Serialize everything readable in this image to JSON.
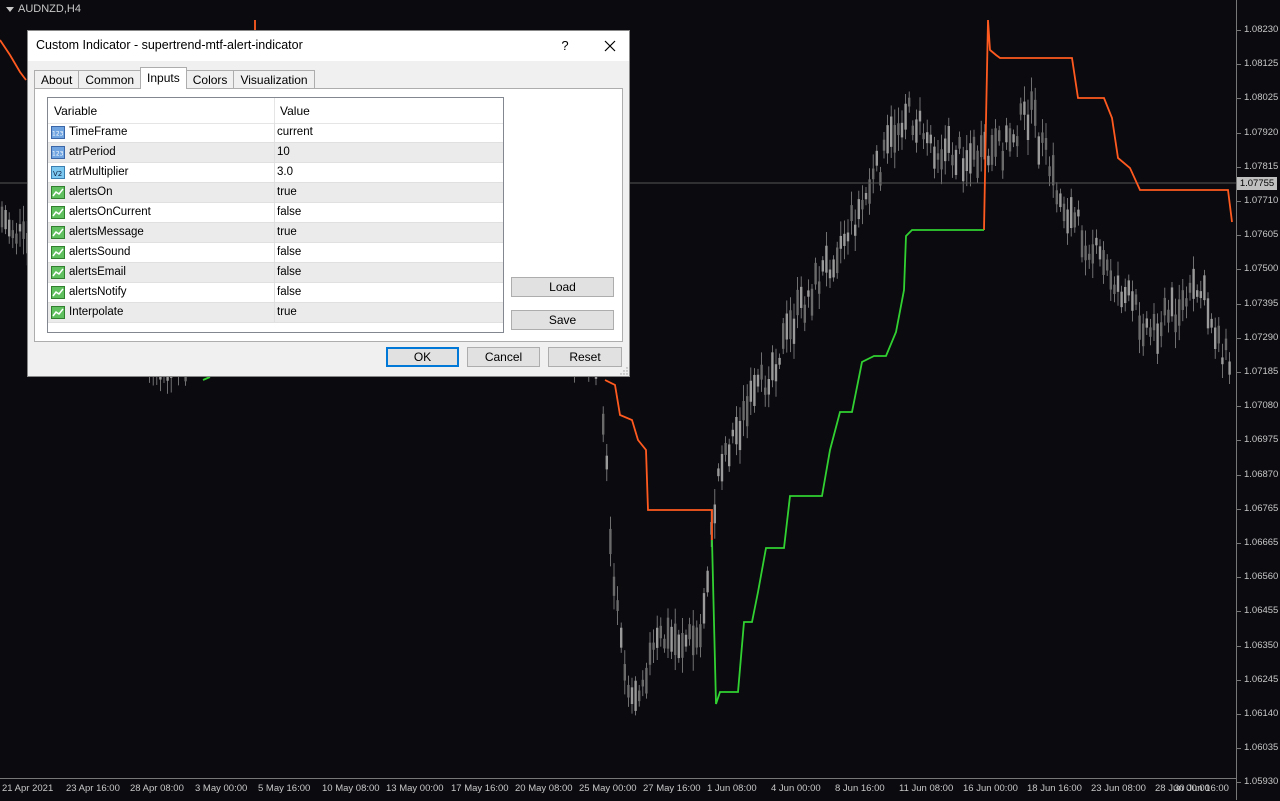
{
  "chart": {
    "symbol": "AUDNZD,H4",
    "colors": {
      "background": "#0a0a0f",
      "candle": "#8a8a8a",
      "trend_down": "#ff5a1f",
      "trend_up": "#32d132",
      "axis_text": "#c8c8c8"
    },
    "current_price": "1.07755",
    "price_ticks": [
      "1.08230",
      "1.08125",
      "1.08025",
      "1.07920",
      "1.07815",
      "1.07710",
      "1.07605",
      "1.07500",
      "1.07395",
      "1.07290",
      "1.07185",
      "1.07080",
      "1.06975",
      "1.06870",
      "1.06765",
      "1.06665",
      "1.06560",
      "1.06455",
      "1.06350",
      "1.06245",
      "1.06140",
      "1.06035",
      "1.05930"
    ],
    "time_ticks": [
      "21 Apr 2021",
      "23 Apr 16:00",
      "28 Apr 08:00",
      "3 May 00:00",
      "5 May 16:00",
      "10 May 08:00",
      "13 May 00:00",
      "17 May 16:00",
      "20 May 08:00",
      "25 May 00:00",
      "27 May 16:00",
      "1 Jun 08:00",
      "4 Jun 00:00",
      "8 Jun 16:00",
      "11 Jun 08:00",
      "16 Jun 00:00",
      "18 Jun 16:00",
      "23 Jun 08:00",
      "28 Jun 00:00",
      "30 Jun 16:00"
    ]
  },
  "dialog": {
    "title": "Custom Indicator - supertrend-mtf-alert-indicator",
    "help_label": "?",
    "tabs": [
      {
        "label": "About"
      },
      {
        "label": "Common"
      },
      {
        "label": "Inputs"
      },
      {
        "label": "Colors"
      },
      {
        "label": "Visualization"
      }
    ],
    "active_tab": "Inputs",
    "table": {
      "col_variable": "Variable",
      "col_value": "Value",
      "rows": [
        {
          "icon": "int-icon",
          "name": "TimeFrame",
          "value": "current"
        },
        {
          "icon": "int-icon",
          "name": "atrPeriod",
          "value": "10"
        },
        {
          "icon": "double-icon",
          "name": "atrMultiplier",
          "value": "3.0"
        },
        {
          "icon": "bool-icon",
          "name": "alertsOn",
          "value": "true"
        },
        {
          "icon": "bool-icon",
          "name": "alertsOnCurrent",
          "value": "false"
        },
        {
          "icon": "bool-icon",
          "name": "alertsMessage",
          "value": "true"
        },
        {
          "icon": "bool-icon",
          "name": "alertsSound",
          "value": "false"
        },
        {
          "icon": "bool-icon",
          "name": "alertsEmail",
          "value": "false"
        },
        {
          "icon": "bool-icon",
          "name": "alertsNotify",
          "value": "false"
        },
        {
          "icon": "bool-icon",
          "name": "Interpolate",
          "value": "true"
        }
      ]
    },
    "buttons": {
      "load": "Load",
      "save": "Save",
      "ok": "OK",
      "cancel": "Cancel",
      "reset": "Reset"
    }
  }
}
